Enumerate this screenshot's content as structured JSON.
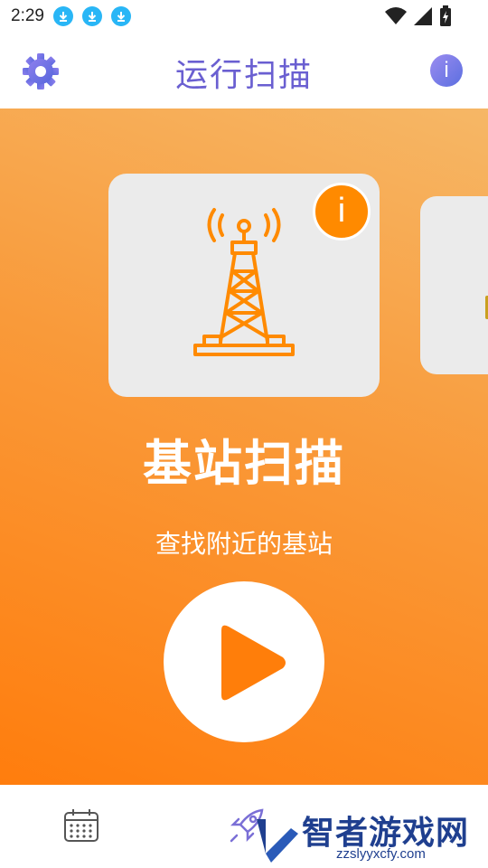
{
  "status_bar": {
    "time": "2:29",
    "icons": [
      "download-icon",
      "download-icon",
      "download-icon",
      "wifi-icon",
      "signal-icon",
      "battery-charging-icon"
    ]
  },
  "app_bar": {
    "title": "运行扫描",
    "settings_icon": "gear-icon",
    "info_label": "i"
  },
  "carousel": {
    "current_card": {
      "icon": "cell-tower-icon",
      "info_label": "i",
      "title": "基站扫描",
      "subtitle": "查找附近的基站"
    }
  },
  "actions": {
    "play_icon": "play-icon"
  },
  "bottom_nav": {
    "items": [
      "calendar-icon",
      "rocket-icon"
    ]
  },
  "watermark": {
    "text": "智者游戏网",
    "url": "zzslyyxcfy.com"
  },
  "colors": {
    "accent_purple": "#6a5fd1",
    "hero_orange_top": "#f6b766",
    "hero_orange_bottom": "#ff7d0d",
    "icon_orange": "#ff8a00",
    "card_bg": "#ebebeb",
    "download_blue": "#29b6f6"
  }
}
